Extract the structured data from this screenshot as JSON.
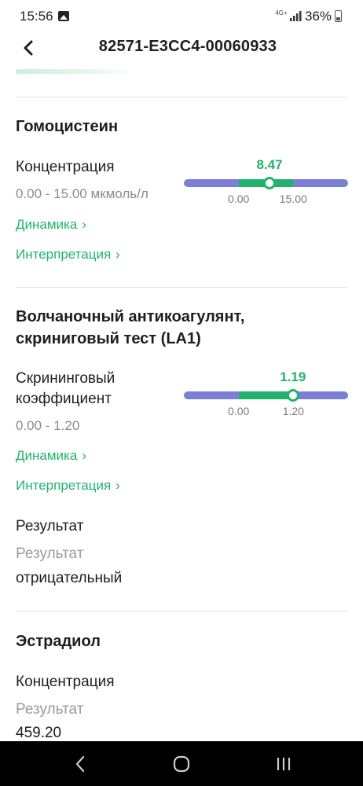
{
  "status_bar": {
    "time": "15:56",
    "network": "4G+",
    "battery": "36%"
  },
  "header": {
    "title": "82571-E3CC4-00060933"
  },
  "sections": [
    {
      "title": "Гомоцистеин",
      "param_label": "Концентрация",
      "range": "0.00 - 15.00 мкмоль/л",
      "value": "8.47",
      "value_number": 8.47,
      "norm_min": "0.00",
      "norm_max": "15.00",
      "norm_min_number": 0,
      "norm_max_number": 15,
      "dynamics_link": "Динамика",
      "interpretation_link": "Интерпретация"
    },
    {
      "title_line1": "Волчаночный антикоагулянт,",
      "title_line2": "скриниговый тест (LA1)",
      "param_label_line1": "Скрининговый",
      "param_label_line2": "коэффициент",
      "range": "0.00 - 1.20",
      "value": "1.19",
      "value_number": 1.19,
      "norm_min": "0.00",
      "norm_max": "1.20",
      "norm_min_number": 0,
      "norm_max_number": 1.2,
      "dynamics_link": "Динамика",
      "interpretation_link": "Интерпретация",
      "result_heading": "Результат",
      "result_label": "Результат",
      "result_value": "отрицательный"
    },
    {
      "title": "Эстрадиол",
      "param_label": "Концентрация",
      "result_label": "Результат",
      "result_value": "459.20"
    }
  ],
  "colors": {
    "accent_green": "#21b36b",
    "out_of_range": "#7b80d6"
  }
}
